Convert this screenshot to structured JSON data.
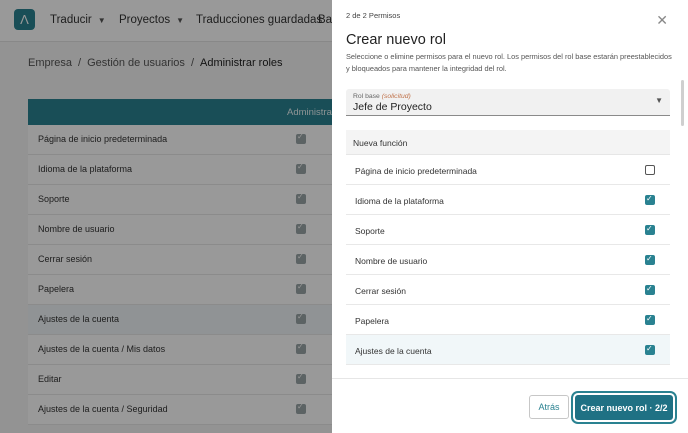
{
  "topnav": {
    "items": [
      {
        "label": "Traducir",
        "dropdown": true
      },
      {
        "label": "Proyectos",
        "dropdown": true
      },
      {
        "label": "Traducciones guardadas",
        "dropdown": false
      },
      {
        "label": "Ba",
        "dropdown": false
      }
    ]
  },
  "breadcrumb": [
    "Empresa",
    "Gestión de usuarios",
    "Administrar roles"
  ],
  "table": {
    "column_header": "Administrac",
    "rows": [
      {
        "label": "Página de inicio predeterminada",
        "checked": true
      },
      {
        "label": "Idioma de la plataforma",
        "checked": true
      },
      {
        "label": "Soporte",
        "checked": true
      },
      {
        "label": "Nombre de usuario",
        "checked": true
      },
      {
        "label": "Cerrar sesión",
        "checked": true
      },
      {
        "label": "Papelera",
        "checked": true
      },
      {
        "label": "Ajustes de la cuenta",
        "checked": true
      },
      {
        "label": "Ajustes de la cuenta / Mis datos",
        "checked": true
      },
      {
        "label": "Editar",
        "checked": true
      },
      {
        "label": "Ajustes de la cuenta / Seguridad",
        "checked": true
      }
    ]
  },
  "drawer": {
    "step": "2 de 2 Permisos",
    "title": "Crear nuevo rol",
    "description": "Seleccione o elimine permisos para el nuevo rol. Los permisos del rol base estarán preestablecidos y bloqueados para mantener la integridad del rol.",
    "base_role": {
      "label": "Rol base",
      "hint": "(solicitud)",
      "value": "Jefe de Proyecto"
    },
    "permissions_header": "Nueva función",
    "permissions": [
      {
        "label": "Página de inicio predeterminada",
        "checked": false
      },
      {
        "label": "Idioma de la plataforma",
        "checked": true
      },
      {
        "label": "Soporte",
        "checked": true
      },
      {
        "label": "Nombre de usuario",
        "checked": true
      },
      {
        "label": "Cerrar sesión",
        "checked": true
      },
      {
        "label": "Papelera",
        "checked": true
      },
      {
        "label": "Ajustes de la cuenta",
        "checked": true
      }
    ],
    "back_label": "Atrás",
    "create_label": "Crear nuevo rol · 2/2"
  },
  "colors": {
    "accent": "#2a8291",
    "primary_button": "#1f7184",
    "base_role_hint": "#c0724a"
  },
  "icons": {
    "logo": "logo-icon",
    "close": "close-icon",
    "dropdown": "chevron-down-icon",
    "check": "check-icon"
  }
}
